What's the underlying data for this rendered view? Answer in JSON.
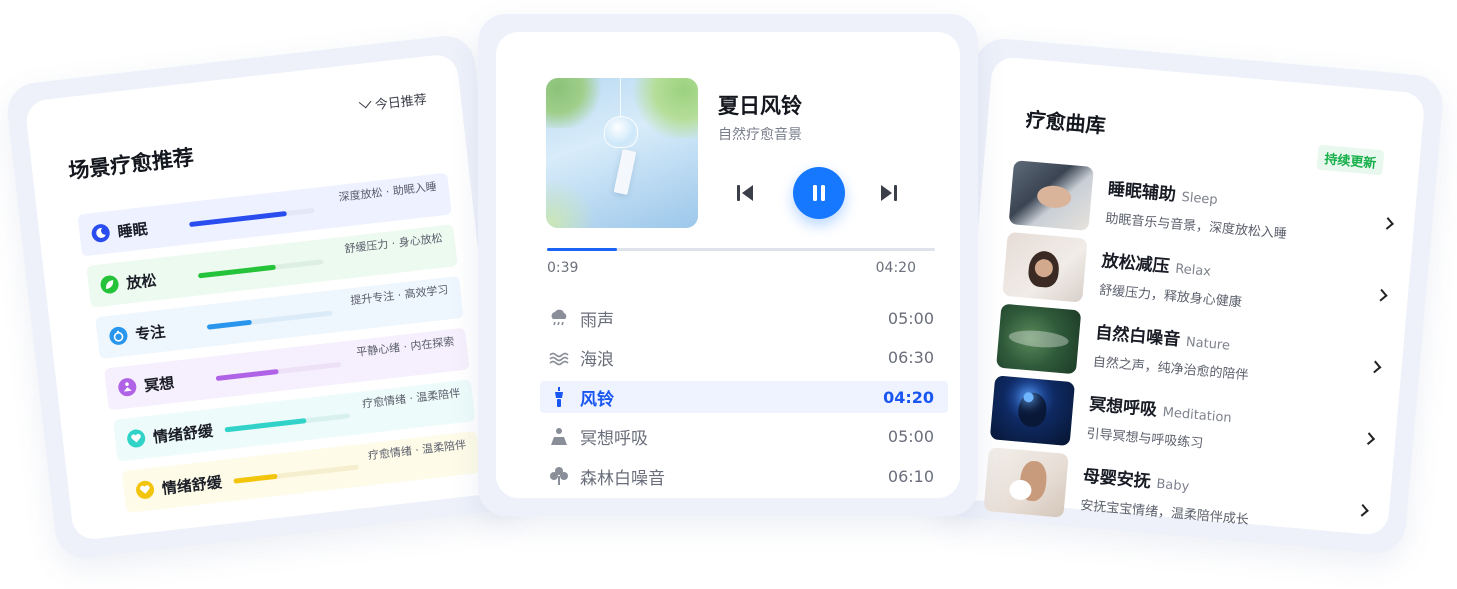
{
  "scene_card": {
    "title": "场景疗愈推荐",
    "filter_label": "今日推荐",
    "items": [
      {
        "label": "睡眠",
        "desc": "深度放松 · 助眠入睡",
        "icon": "moon-icon",
        "color": "#2a4df0",
        "bg": "#eef1ff",
        "track": "#e3e7f6",
        "progress": 0.78
      },
      {
        "label": "放松",
        "desc": "舒缓压力 · 身心放松",
        "icon": "leaf-icon",
        "color": "#25c33a",
        "bg": "#edfaf0",
        "track": "#dcefe0",
        "progress": 0.62
      },
      {
        "label": "专注",
        "desc": "提升专注 · 高效学习",
        "icon": "timer-icon",
        "color": "#2996ee",
        "bg": "#eef6fe",
        "track": "#dcebf8",
        "progress": 0.36
      },
      {
        "label": "冥想",
        "desc": "平静心绪 · 内在探索",
        "icon": "meditation-icon",
        "color": "#b062e6",
        "bg": "#f6effd",
        "track": "#ece1f6",
        "progress": 0.5
      },
      {
        "label": "情绪舒缓",
        "desc": "疗愈情绪 · 温柔陪伴",
        "icon": "heart-icon",
        "color": "#31d3c8",
        "bg": "#edfbfa",
        "track": "#d8f1ef",
        "progress": 0.65
      },
      {
        "label": "情绪舒缓",
        "desc": "疗愈情绪 · 温柔陪伴",
        "icon": "heart-icon",
        "color": "#f3c40c",
        "bg": "#fefbe8",
        "track": "#f6efcf",
        "progress": 0.35
      }
    ]
  },
  "player": {
    "title": "夏日风铃",
    "subtitle": "自然疗愈音景",
    "current_time": "0:39",
    "total_time": "04:20",
    "progress": 0.18,
    "accent": "#1677ff",
    "tracks": [
      {
        "name": "雨声",
        "duration": "05:00",
        "icon": "rain-icon",
        "active": false
      },
      {
        "name": "海浪",
        "duration": "06:30",
        "icon": "waves-icon",
        "active": false
      },
      {
        "name": "风铃",
        "duration": "04:20",
        "icon": "wind-chime-icon",
        "active": true
      },
      {
        "name": "冥想呼吸",
        "duration": "05:00",
        "icon": "meditation-icon",
        "active": false
      },
      {
        "name": "森林白噪音",
        "duration": "06:10",
        "icon": "tree-icon",
        "active": false
      }
    ]
  },
  "library": {
    "title": "疗愈曲库",
    "badge": "持续更新",
    "badge_color": "#17b04a",
    "items": [
      {
        "name": "睡眠辅助",
        "en": "Sleep",
        "desc": "助眠音乐与音景，深度放松入睡",
        "thumb": "sleep"
      },
      {
        "name": "放松减压",
        "en": "Relax",
        "desc": "舒缓压力，释放身心健康",
        "thumb": "relax"
      },
      {
        "name": "自然白噪音",
        "en": "Nature",
        "desc": "自然之声，纯净治愈的陪伴",
        "thumb": "nature"
      },
      {
        "name": "冥想呼吸",
        "en": "Meditation",
        "desc": "引导冥想与呼吸练习",
        "thumb": "med"
      },
      {
        "name": "母婴安抚",
        "en": "Baby",
        "desc": "安抚宝宝情绪，温柔陪伴成长",
        "thumb": "baby"
      }
    ]
  }
}
